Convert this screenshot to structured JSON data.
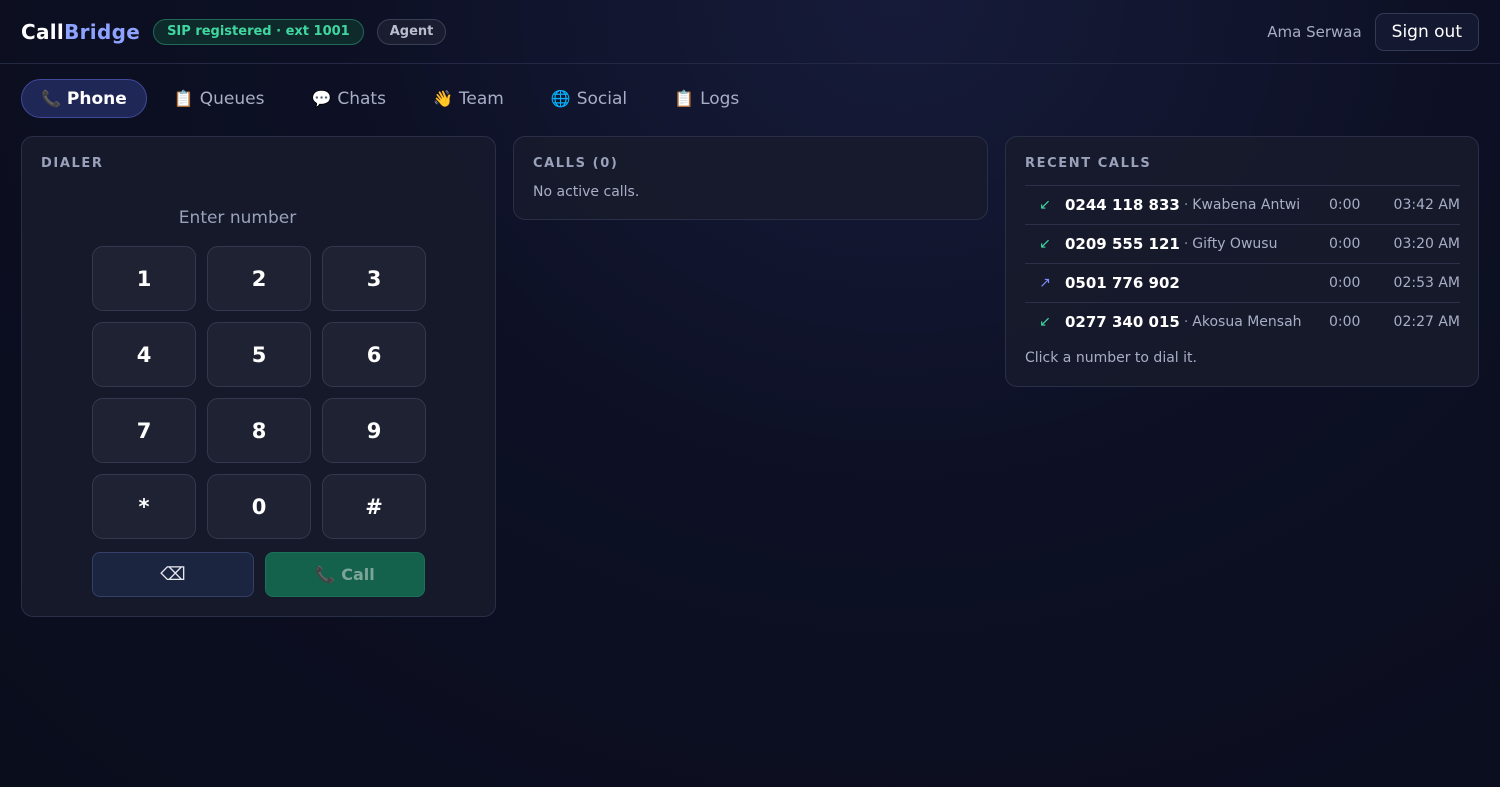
{
  "app": {
    "brand_part1": "Call",
    "brand_part2": "Bridge"
  },
  "header": {
    "sip_status": "SIP registered · ext 1001",
    "role": "Agent",
    "user_name": "Ama Serwaa",
    "signout_label": "Sign out"
  },
  "tabs": [
    {
      "icon": "phone-icon",
      "glyph": "📞",
      "label": "Phone",
      "active": true
    },
    {
      "icon": "clipboard-icon",
      "glyph": "📋",
      "label": "Queues",
      "active": false
    },
    {
      "icon": "chat-bubble-icon",
      "glyph": "💬",
      "label": "Chats",
      "active": false
    },
    {
      "icon": "waving-hand-icon",
      "glyph": "👋",
      "label": "Team",
      "active": false
    },
    {
      "icon": "globe-icon",
      "glyph": "🌐",
      "label": "Social",
      "active": false
    },
    {
      "icon": "clipboard-icon",
      "glyph": "📋",
      "label": "Logs",
      "active": false
    }
  ],
  "dialer": {
    "title": "DIALER",
    "input_value": "",
    "input_placeholder": "Enter number",
    "keys": [
      "1",
      "2",
      "3",
      "4",
      "5",
      "6",
      "7",
      "8",
      "9",
      "*",
      "0",
      "#"
    ],
    "backspace_glyph": "⌫",
    "call_glyph": "📞",
    "call_label": "Call"
  },
  "calls": {
    "title": "CALLS (0)",
    "empty_text": "No active calls."
  },
  "recent": {
    "title": "RECENT CALLS",
    "rows": [
      {
        "direction": "incoming",
        "arrow": "↙",
        "number": "0244 118 833",
        "sep": "·",
        "name": "Kwabena Antwi",
        "duration": "0:00",
        "time": "03:42 AM"
      },
      {
        "direction": "incoming",
        "arrow": "↙",
        "number": "0209 555 121",
        "sep": "·",
        "name": "Gifty Owusu",
        "duration": "0:00",
        "time": "03:20 AM"
      },
      {
        "direction": "outgoing",
        "arrow": "↗",
        "number": "0501 776 902",
        "sep": "",
        "name": "",
        "duration": "0:00",
        "time": "02:53 AM"
      },
      {
        "direction": "incoming",
        "arrow": "↙",
        "number": "0277 340 015",
        "sep": "·",
        "name": "Akosua Mensah",
        "duration": "0:00",
        "time": "02:27 AM"
      }
    ],
    "hint": "Click a number to dial it."
  },
  "colors": {
    "accent": "#8ea2ff",
    "sip_ok": "#3fd6a0",
    "call_button": "#14614c",
    "incoming": "#3fd6a0",
    "outgoing": "#7d8cff"
  }
}
